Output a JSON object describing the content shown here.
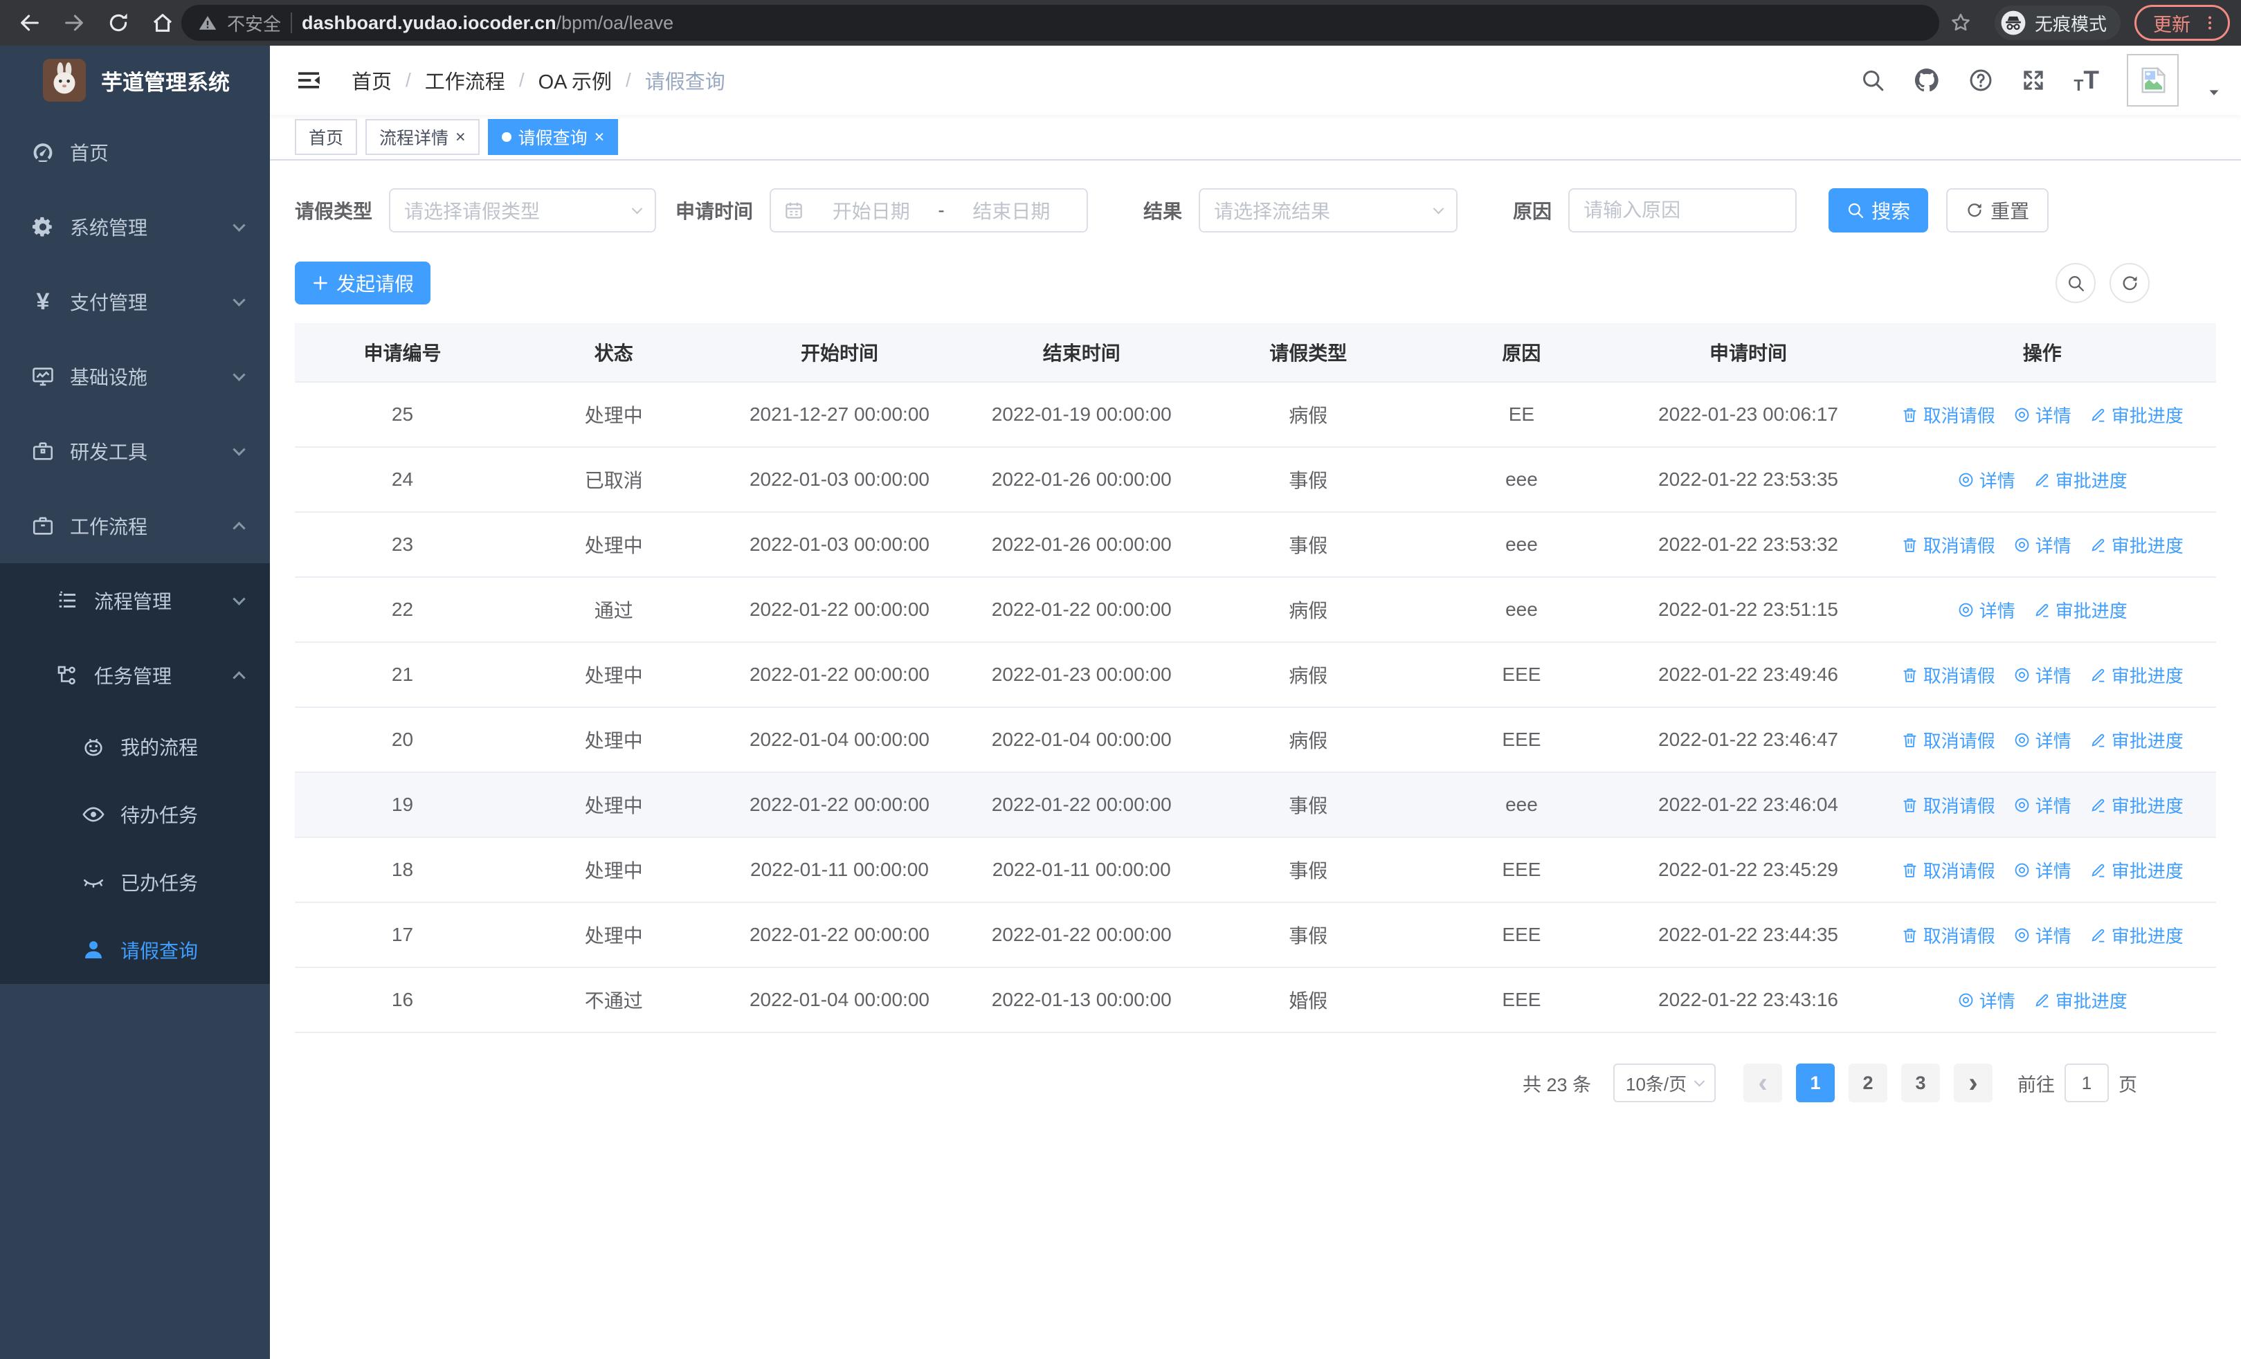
{
  "browser": {
    "security_label": "不安全",
    "url_host": "dashboard.yudao.iocoder.cn",
    "url_path": "/bpm/oa/leave",
    "incognito_label": "无痕模式",
    "update_label": "更新",
    "icons": [
      "back-icon",
      "forward-icon",
      "reload-icon",
      "home-icon",
      "not-secure-warning-icon",
      "bookmark-star-icon",
      "incognito-icon",
      "kebab-menu-icon"
    ]
  },
  "sidebar": {
    "app_title": "芋道管理系统",
    "menu": [
      {
        "label": "首页",
        "icon": "dashboard-icon",
        "level": 1
      },
      {
        "label": "系统管理",
        "icon": "gear-icon",
        "level": 1,
        "arrow": "down"
      },
      {
        "label": "支付管理",
        "icon": "yen-icon",
        "level": 1,
        "arrow": "down"
      },
      {
        "label": "基础设施",
        "icon": "monitor-icon",
        "level": 1,
        "arrow": "down"
      },
      {
        "label": "研发工具",
        "icon": "toolbox-icon",
        "level": 1,
        "arrow": "down"
      },
      {
        "label": "工作流程",
        "icon": "briefcase-icon",
        "level": 1,
        "arrow": "up"
      },
      {
        "label": "流程管理",
        "icon": "list-icon",
        "level": 2,
        "arrow": "down"
      },
      {
        "label": "任务管理",
        "icon": "flow-icon",
        "level": 2,
        "arrow": "up"
      },
      {
        "label": "我的流程",
        "icon": "robot-icon",
        "level": 3
      },
      {
        "label": "待办任务",
        "icon": "eye-icon",
        "level": 3
      },
      {
        "label": "已办任务",
        "icon": "eye-closed-icon",
        "level": 3
      },
      {
        "label": "请假查询",
        "icon": "user-icon",
        "level": 3,
        "active": true
      }
    ]
  },
  "navbar": {
    "breadcrumb": [
      "首页",
      "工作流程",
      "OA 示例",
      "请假查询"
    ],
    "right_icons": [
      "search-icon",
      "github-icon",
      "help-icon",
      "fullscreen-icon",
      "font-size-icon",
      "avatar-broken-image",
      "caret-down-icon"
    ]
  },
  "tabs": [
    {
      "label": "首页",
      "closable": false,
      "active": false
    },
    {
      "label": "流程详情",
      "closable": true,
      "active": false
    },
    {
      "label": "请假查询",
      "closable": true,
      "active": true
    }
  ],
  "filters": {
    "leave_type_label": "请假类型",
    "leave_type_placeholder": "请选择请假类型",
    "apply_time_label": "申请时间",
    "date_start_placeholder": "开始日期",
    "date_separator": "-",
    "date_end_placeholder": "结束日期",
    "result_label": "结果",
    "result_placeholder": "请选择流结果",
    "reason_label": "原因",
    "reason_placeholder": "请输入原因",
    "search_label": "搜索",
    "reset_label": "重置"
  },
  "toolbar": {
    "create_label": "发起请假"
  },
  "table": {
    "columns": [
      "申请编号",
      "状态",
      "开始时间",
      "结束时间",
      "请假类型",
      "原因",
      "申请时间",
      "操作"
    ],
    "actions": {
      "cancel": "取消请假",
      "detail": "详情",
      "progress": "审批进度"
    },
    "rows": [
      {
        "id": "25",
        "status": "处理中",
        "start": "2021-12-27 00:00:00",
        "end": "2022-01-19 00:00:00",
        "type": "病假",
        "reason": "EE",
        "applied": "2022-01-23 00:06:17",
        "actions": [
          "cancel",
          "detail",
          "progress"
        ]
      },
      {
        "id": "24",
        "status": "已取消",
        "start": "2022-01-03 00:00:00",
        "end": "2022-01-26 00:00:00",
        "type": "事假",
        "reason": "eee",
        "applied": "2022-01-22 23:53:35",
        "actions": [
          "detail",
          "progress"
        ]
      },
      {
        "id": "23",
        "status": "处理中",
        "start": "2022-01-03 00:00:00",
        "end": "2022-01-26 00:00:00",
        "type": "事假",
        "reason": "eee",
        "applied": "2022-01-22 23:53:32",
        "actions": [
          "cancel",
          "detail",
          "progress"
        ]
      },
      {
        "id": "22",
        "status": "通过",
        "start": "2022-01-22 00:00:00",
        "end": "2022-01-22 00:00:00",
        "type": "病假",
        "reason": "eee",
        "applied": "2022-01-22 23:51:15",
        "actions": [
          "detail",
          "progress"
        ]
      },
      {
        "id": "21",
        "status": "处理中",
        "start": "2022-01-22 00:00:00",
        "end": "2022-01-23 00:00:00",
        "type": "病假",
        "reason": "EEE",
        "applied": "2022-01-22 23:49:46",
        "actions": [
          "cancel",
          "detail",
          "progress"
        ]
      },
      {
        "id": "20",
        "status": "处理中",
        "start": "2022-01-04 00:00:00",
        "end": "2022-01-04 00:00:00",
        "type": "病假",
        "reason": "EEE",
        "applied": "2022-01-22 23:46:47",
        "actions": [
          "cancel",
          "detail",
          "progress"
        ]
      },
      {
        "id": "19",
        "status": "处理中",
        "start": "2022-01-22 00:00:00",
        "end": "2022-01-22 00:00:00",
        "type": "事假",
        "reason": "eee",
        "applied": "2022-01-22 23:46:04",
        "actions": [
          "cancel",
          "detail",
          "progress"
        ],
        "highlighted": true
      },
      {
        "id": "18",
        "status": "处理中",
        "start": "2022-01-11 00:00:00",
        "end": "2022-01-11 00:00:00",
        "type": "事假",
        "reason": "EEE",
        "applied": "2022-01-22 23:45:29",
        "actions": [
          "cancel",
          "detail",
          "progress"
        ]
      },
      {
        "id": "17",
        "status": "处理中",
        "start": "2022-01-22 00:00:00",
        "end": "2022-01-22 00:00:00",
        "type": "事假",
        "reason": "EEE",
        "applied": "2022-01-22 23:44:35",
        "actions": [
          "cancel",
          "detail",
          "progress"
        ]
      },
      {
        "id": "16",
        "status": "不通过",
        "start": "2022-01-04 00:00:00",
        "end": "2022-01-13 00:00:00",
        "type": "婚假",
        "reason": "EEE",
        "applied": "2022-01-22 23:43:16",
        "actions": [
          "detail",
          "progress"
        ]
      }
    ]
  },
  "pagination": {
    "total_label": "共 23 条",
    "page_size": "10条/页",
    "pages": [
      "1",
      "2",
      "3"
    ],
    "active_page": "1",
    "goto_label": "前往",
    "goto_value": "1",
    "page_unit": "页"
  },
  "colors": {
    "accent": "#409eff",
    "sidebar_bg": "#304156",
    "submenu_bg": "#1f2d3d",
    "update_chip": "#f28b82"
  }
}
